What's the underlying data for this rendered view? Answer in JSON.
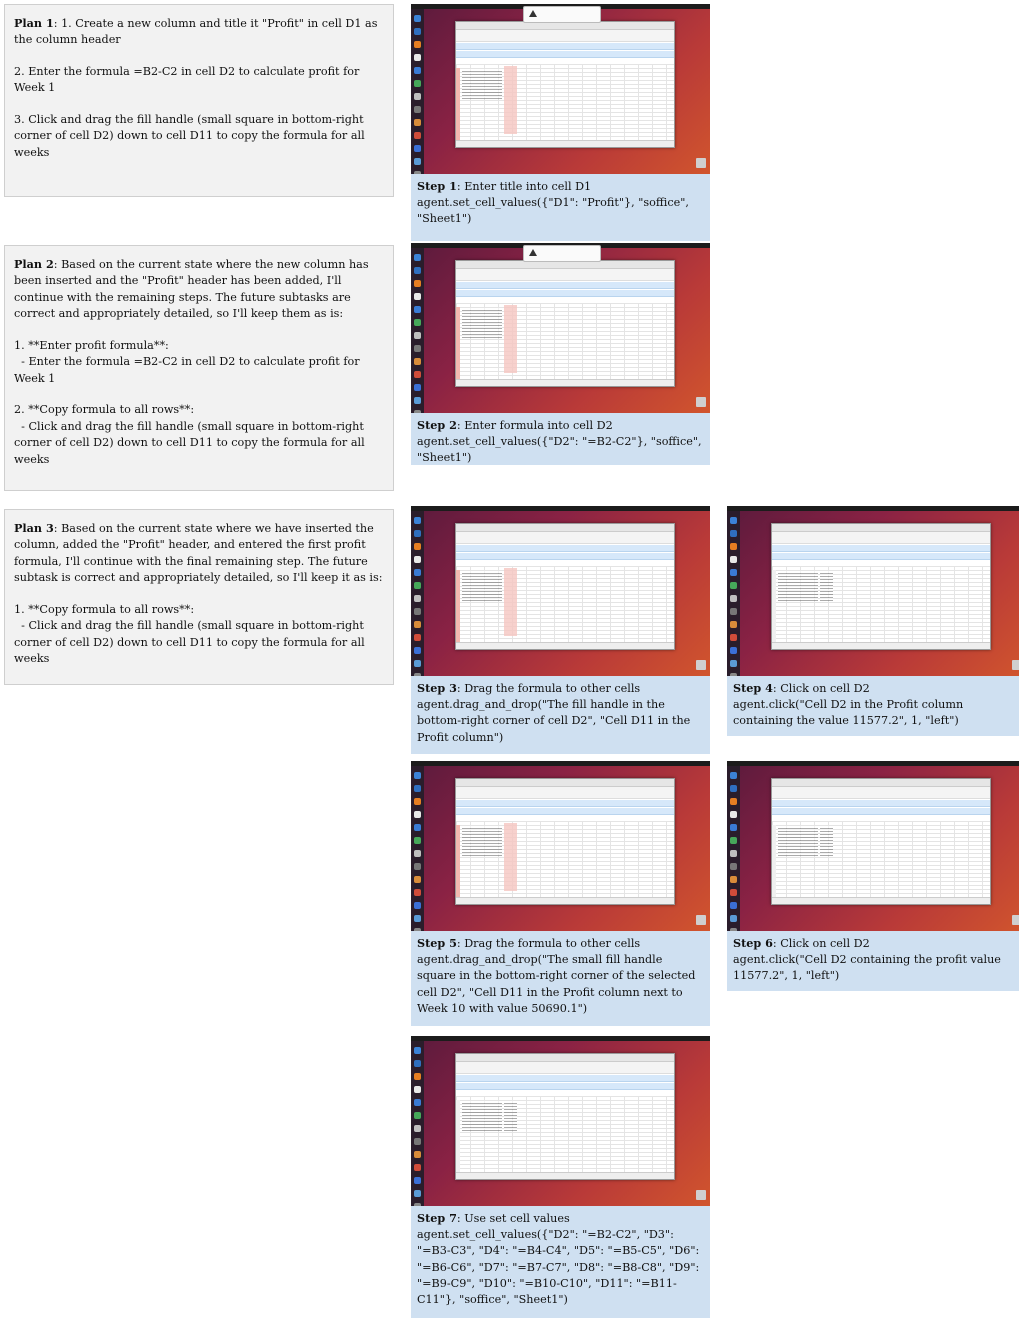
{
  "plans": [
    {
      "label": "Plan 1",
      "lines": [
        "1. Create a new column and title it \"Profit\" in cell D1 as the column header",
        "",
        "2. Enter the formula =B2-C2 in cell D2 to calculate profit for Week 1",
        "",
        "3. Click and drag the fill handle (small square in bottom-right corner of cell D2) down to cell D11 to copy the formula for all weeks"
      ]
    },
    {
      "label": "Plan 2",
      "lines": [
        "Based on the current state where the new column has been inserted and the \"Profit\" header has been added, I'll continue with the remaining steps. The future subtasks are correct and appropriately detailed, so I'll keep them as is:",
        "",
        "1. **Enter profit formula**:",
        "  - Enter the formula =B2-C2 in cell D2 to calculate profit for Week 1",
        "",
        "2. **Copy formula to all rows**:",
        "  - Click and drag the fill handle (small square in bottom-right corner of cell D2) down to cell D11 to copy the formula for all weeks"
      ]
    },
    {
      "label": "Plan 3",
      "lines": [
        "Based on the current state where we have inserted the column, added the \"Profit\" header, and entered the first profit formula, I'll continue with the final remaining step. The future subtask is correct and appropriately detailed, so I'll keep it as is:",
        "",
        "1. **Copy formula to all rows**:",
        "  - Click and drag the fill handle (small square in bottom-right corner of cell D2) down to cell D11 to copy the formula for all weeks"
      ]
    }
  ],
  "steps": [
    {
      "label": "Step 1",
      "title": "Enter title into cell D1",
      "action": "agent.set_cell_values({\"D1\": \"Profit\"}, \"soffice\", \"Sheet1\")"
    },
    {
      "label": "Step 2",
      "title": "Enter formula into cell D2",
      "action": "agent.set_cell_values({\"D2\": \"=B2-C2\"}, \"soffice\", \"Sheet1\")"
    },
    {
      "label": "Step 3",
      "title": "Drag the formula to other cells",
      "action": "agent.drag_and_drop(\"The fill handle in the bottom-right corner of cell D2\", \"Cell D11 in the Profit column\")"
    },
    {
      "label": "Step 4",
      "title": "Click on cell D2",
      "action": "agent.click(\"Cell D2 in the Profit column containing the value 11577.2\", 1, \"left\")"
    },
    {
      "label": "Step 5",
      "title": "Drag the formula to other cells",
      "action": "agent.drag_and_drop(\"The small fill handle square in the bottom-right corner of the selected cell D2\", \"Cell D11 in the Profit column next to Week 10 with value 50690.1\")"
    },
    {
      "label": "Step 6",
      "title": "Click on cell D2",
      "action": "agent.click(\"Cell D2 containing the profit value 11577.2\", 1, \"left\")"
    },
    {
      "label": "Step 7",
      "title": "Use set cell values",
      "action": "agent.set_cell_values({\"D2\": \"=B2-C2\", \"D3\": \"=B3-C3\", \"D4\": \"=B4-C4\", \"D5\": \"=B5-C5\", \"D6\": \"=B6-C6\", \"D7\": \"=B7-C7\", \"D8\": \"=B8-C8\", \"D9\": \"=B9-C9\", \"D10\": \"=B10-C10\", \"D11\": \"=B11-C11\"}, \"soffice\", \"Sheet1\")"
    }
  ]
}
